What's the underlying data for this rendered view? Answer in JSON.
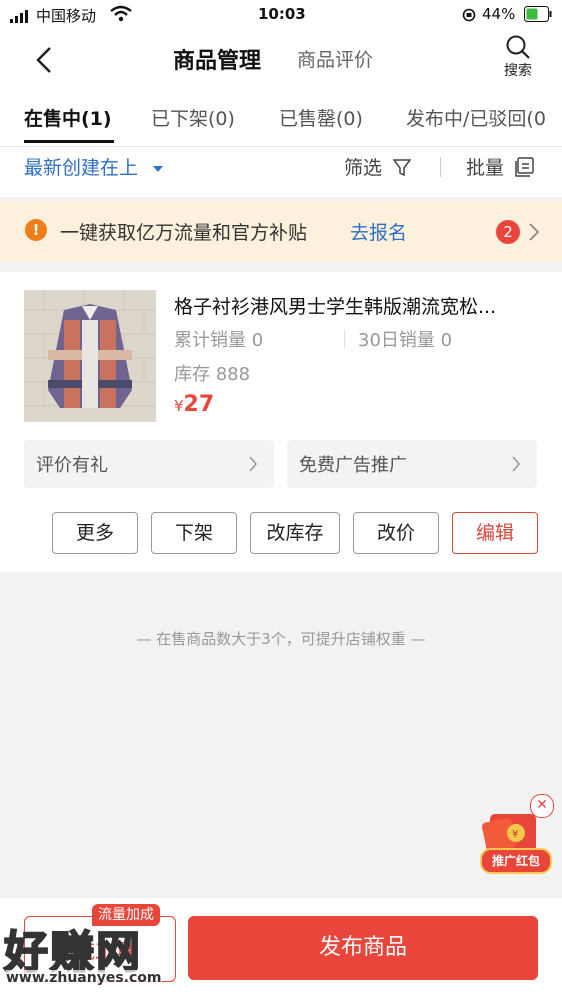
{
  "status_bar": {
    "carrier": "中国移动",
    "time": "10:03",
    "battery": "44%"
  },
  "nav": {
    "title": "商品管理",
    "secondary_tab": "商品评价",
    "search_label": "搜索"
  },
  "tabs": [
    {
      "label": "在售中(1)"
    },
    {
      "label": "已下架(0)"
    },
    {
      "label": "已售罄(0)"
    },
    {
      "label": "发布中/已驳回(0"
    }
  ],
  "sort": {
    "label": "最新创建在上",
    "filter_label": "筛选",
    "batch_label": "批量"
  },
  "banner": {
    "text": "一键获取亿万流量和官方补贴",
    "link": "去报名",
    "badge": "2"
  },
  "product": {
    "title": "格子衬衫港风男士学生韩版潮流宽松...",
    "total_sales": "累计销量 0",
    "sales_30d": "30日销量 0",
    "stock": "库存 888",
    "price_symbol": "¥",
    "price": "27",
    "review_gift": "评价有礼",
    "free_ads": "免费广告推广",
    "actions": {
      "more": "更多",
      "delist": "下架",
      "edit_stock": "改库存",
      "edit_price": "改价",
      "edit": "编辑"
    }
  },
  "hint": "— 在售商品数大于3个，可提升店铺权重 —",
  "promo": {
    "label": "推广红包"
  },
  "bottom": {
    "traffic_badge": "流量加成",
    "left_button": "引流工具",
    "publish_button": "发布商品"
  },
  "watermark": {
    "text": "好赚网",
    "url": "www.zhuanyes.com"
  },
  "colors": {
    "accent": "#e8453b",
    "link": "#2f6fc4",
    "banner_bg": "#fdf1de"
  }
}
